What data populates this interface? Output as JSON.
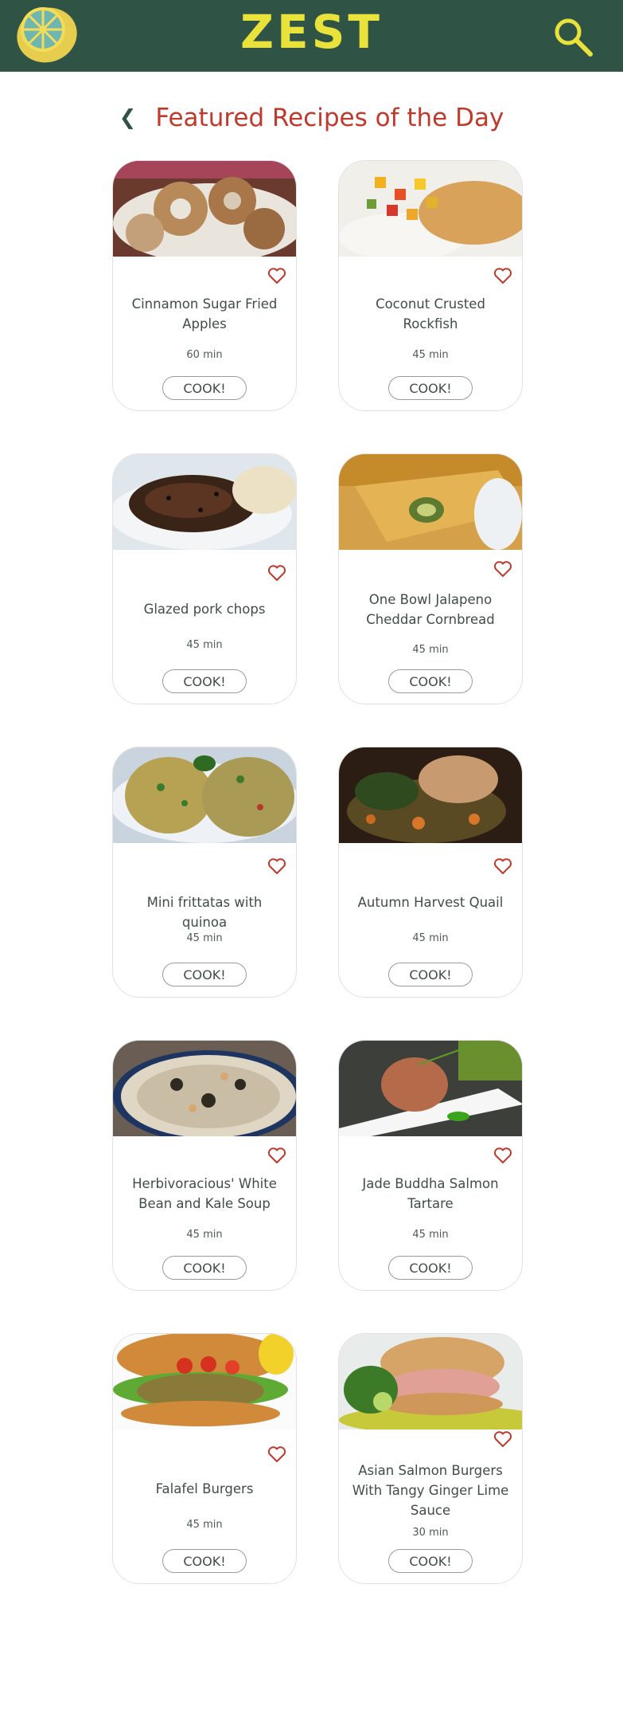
{
  "header": {
    "brand": "ZEST",
    "logo_icon": "lemon-logo-icon",
    "search_icon": "search-icon"
  },
  "page": {
    "back_icon": "chevron-left-icon",
    "back_glyph": "❮",
    "title": "Featured Recipes of the Day"
  },
  "recipes": [
    {
      "name": "Cinnamon Sugar Fried Apples",
      "time": "60 min",
      "cook_label": "COOK!"
    },
    {
      "name": "Coconut Crusted Rockfish",
      "time": "45 min",
      "cook_label": "COOK!"
    },
    {
      "name": "Glazed pork chops",
      "time": "45 min",
      "cook_label": "COOK!"
    },
    {
      "name": "One Bowl Jalapeno Cheddar Cornbread",
      "time": "45 min",
      "cook_label": "COOK!"
    },
    {
      "name": "Mini frittatas with quinoa",
      "time": "45 min",
      "cook_label": "COOK!"
    },
    {
      "name": "Autumn Harvest Quail",
      "time": "45 min",
      "cook_label": "COOK!"
    },
    {
      "name": "Herbivoracious' White Bean and Kale Soup",
      "time": "45 min",
      "cook_label": "COOK!"
    },
    {
      "name": "Jade Buddha Salmon Tartare",
      "time": "45 min",
      "cook_label": "COOK!"
    },
    {
      "name": "Falafel Burgers",
      "time": "45 min",
      "cook_label": "COOK!"
    },
    {
      "name": "Asian Salmon Burgers With Tangy Ginger Lime Sauce",
      "time": "30 min",
      "cook_label": "COOK!"
    }
  ],
  "colors": {
    "header_bg": "#2f5446",
    "brand": "#e9e23b",
    "title": "#c0392b",
    "heart": "#c0392b",
    "text": "#3f4d48"
  }
}
